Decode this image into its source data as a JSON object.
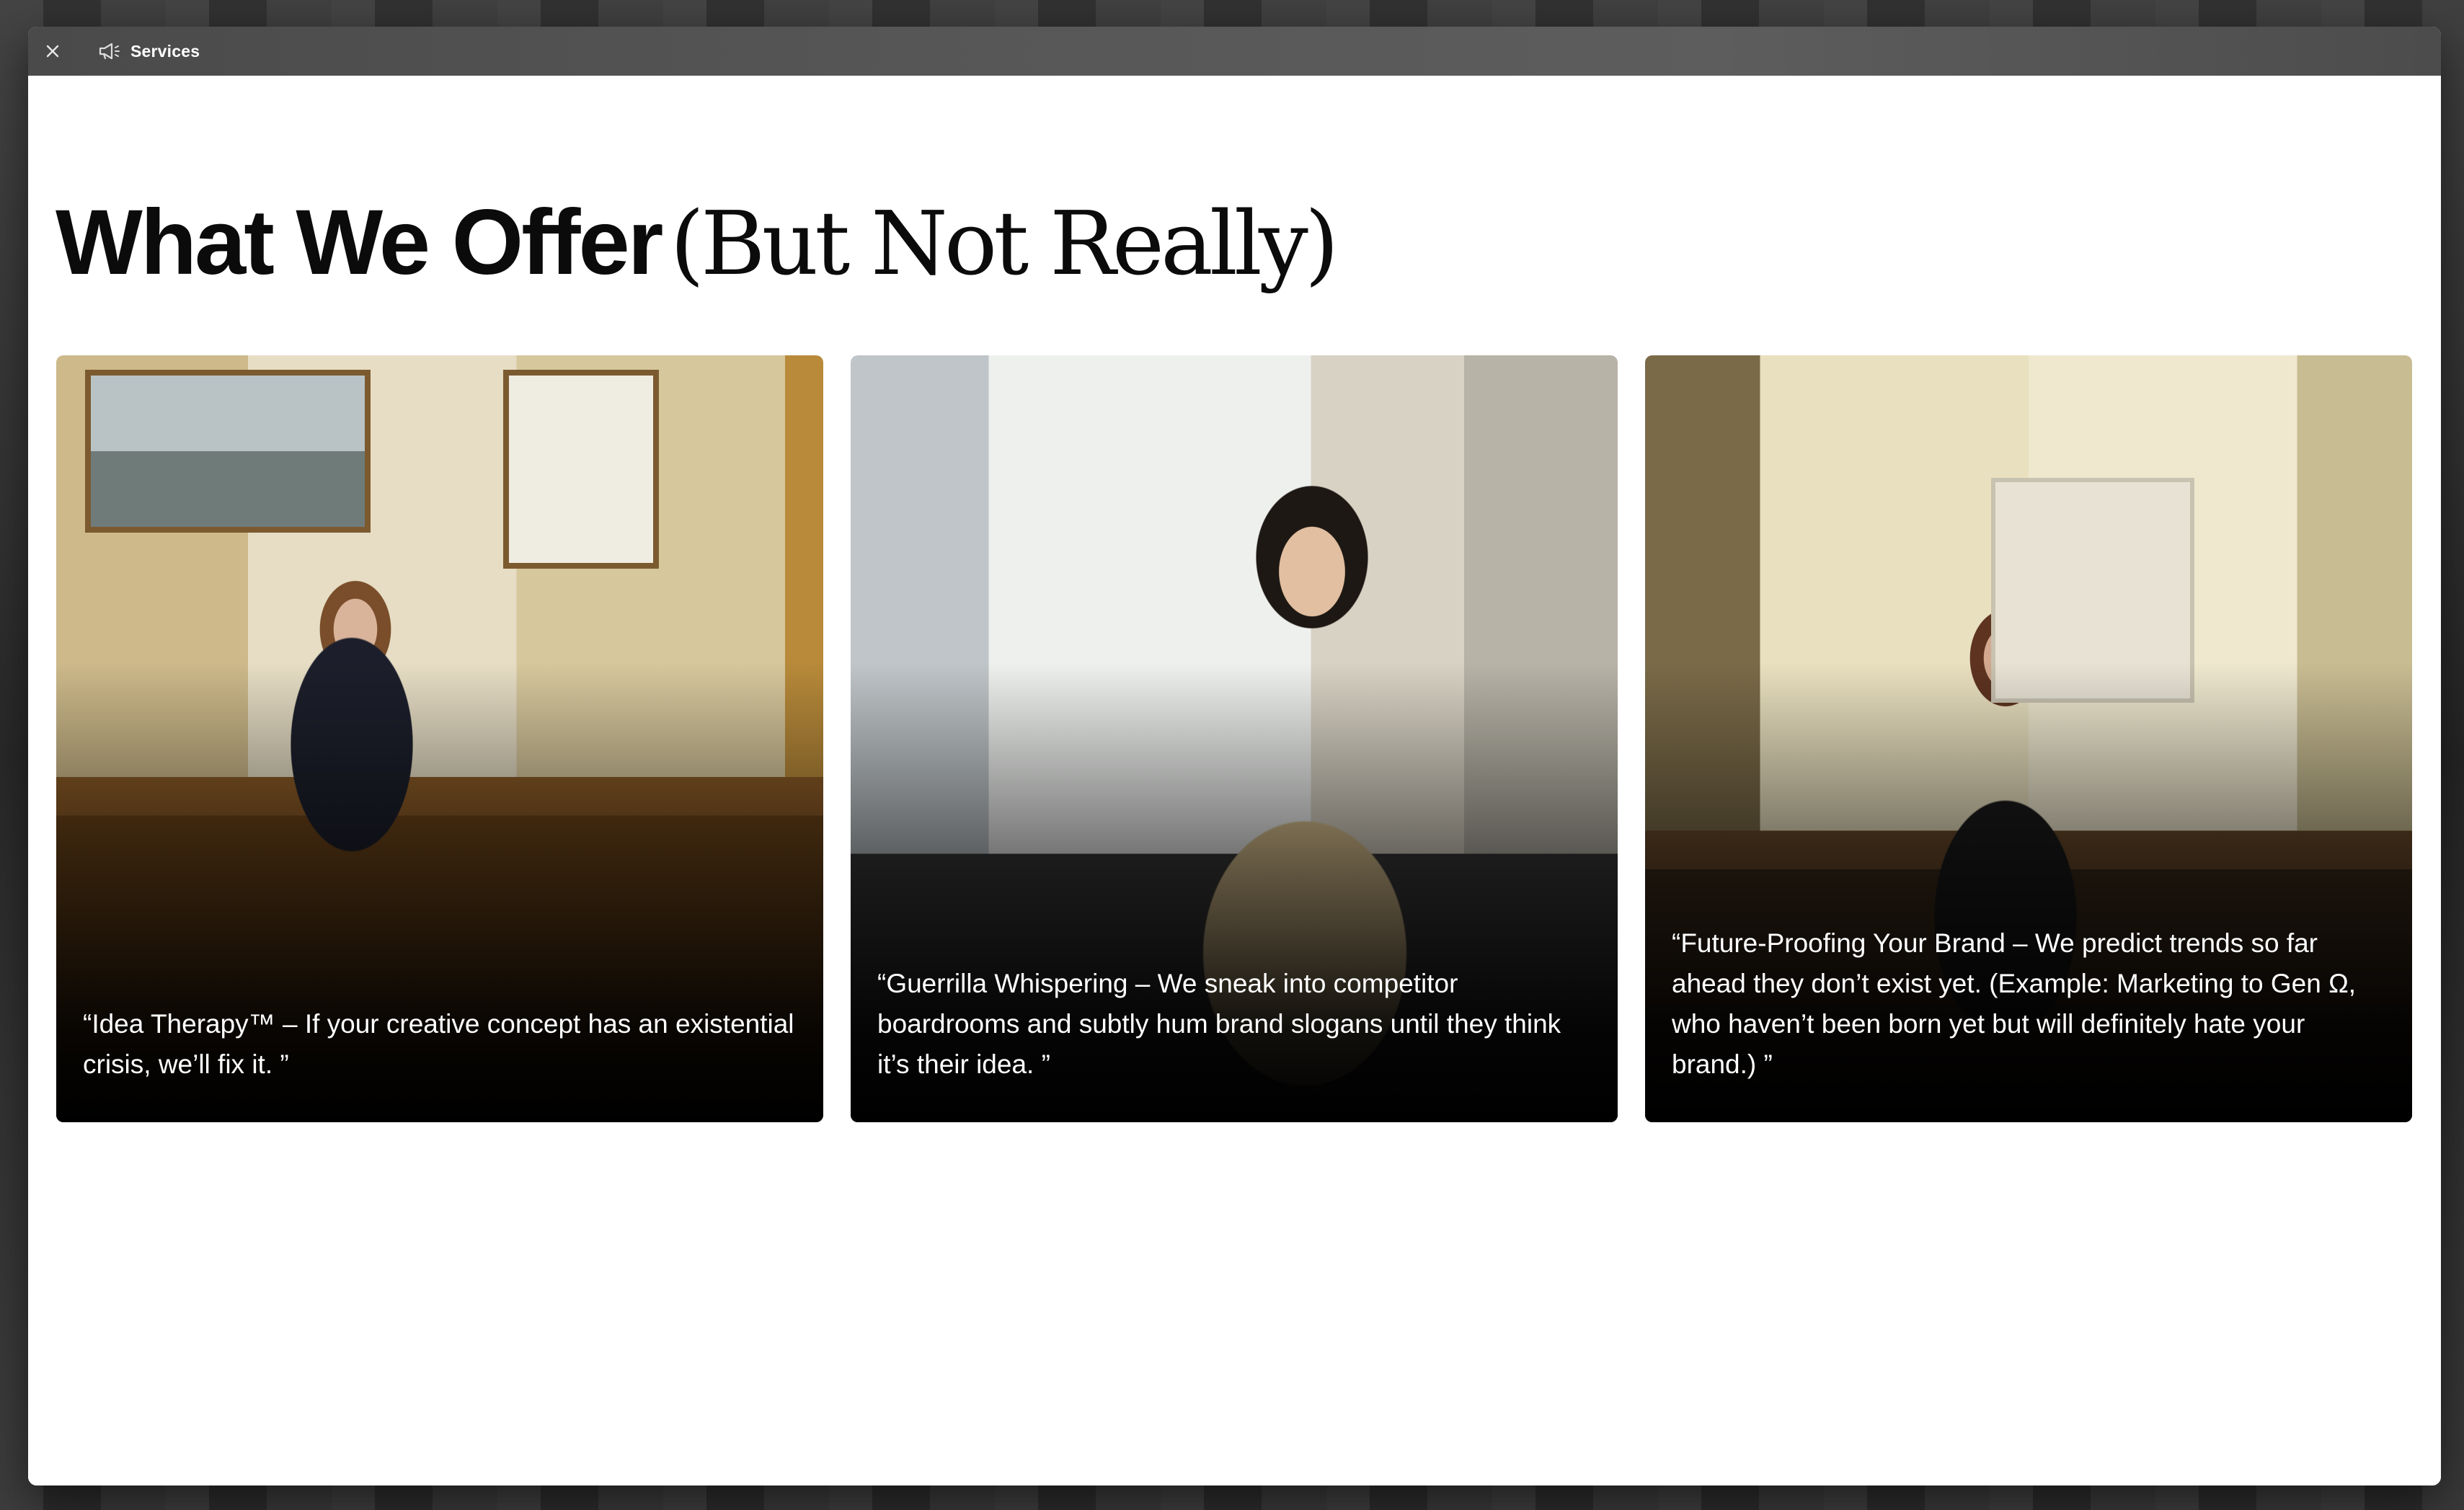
{
  "window": {
    "tab_label": "Services",
    "close_icon": "close-icon",
    "tab_icon": "megaphone-icon"
  },
  "page": {
    "title_main": "What We Offer",
    "title_aside": "(But Not Really)"
  },
  "services": [
    {
      "text": "“Idea Therapy™ – If your creative concept has an existential crisis, we’ll fix it. ”",
      "image": "woman-at-office-desk-photo"
    },
    {
      "text": "“Guerrilla Whispering – We sneak into competitor boardrooms and subtly hum brand slogans until they think it’s their idea. ”",
      "image": "woman-in-beige-shirt-photo"
    },
    {
      "text": "“Future-Proofing Your Brand – We predict trends so far ahead they don’t exist yet. (Example: Marketing to Gen Ω, who haven’t been born yet but will definitely hate your brand.) ”",
      "image": "woman-in-dark-blazer-photo"
    }
  ],
  "colors": {
    "titlebar": "#555555",
    "page_bg": "#ffffff",
    "title_text": "#0b0b0b",
    "card_text": "#ffffff"
  }
}
